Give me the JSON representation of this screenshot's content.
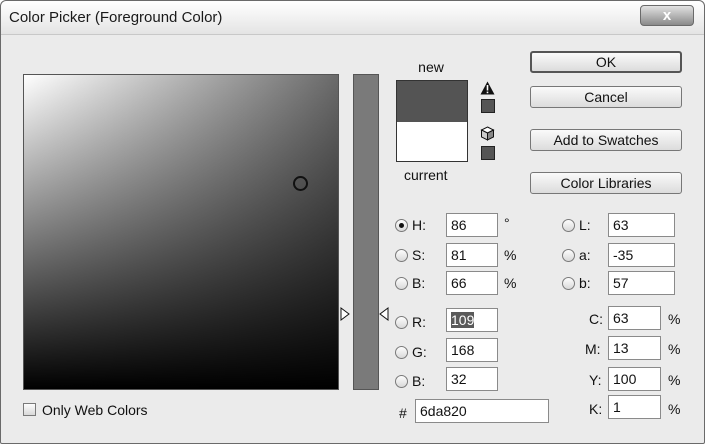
{
  "window": {
    "title": "Color Picker (Foreground Color)",
    "close_glyph": "x"
  },
  "swatches": {
    "new_label": "new",
    "current_label": "current"
  },
  "buttons": {
    "ok": "OK",
    "cancel": "Cancel",
    "add_to_swatches": "Add to Swatches",
    "color_libraries": "Color Libraries"
  },
  "hsb": {
    "h": {
      "label": "H:",
      "value": "86",
      "unit": "°",
      "selected": true
    },
    "s": {
      "label": "S:",
      "value": "81",
      "unit": "%"
    },
    "b": {
      "label": "B:",
      "value": "66",
      "unit": "%"
    }
  },
  "rgb": {
    "r": {
      "label": "R:",
      "value": "109"
    },
    "g": {
      "label": "G:",
      "value": "168"
    },
    "b": {
      "label": "B:",
      "value": "32"
    }
  },
  "lab": {
    "l": {
      "label": "L:",
      "value": "63"
    },
    "a": {
      "label": "a:",
      "value": "-35"
    },
    "b": {
      "label": "b:",
      "value": "57"
    }
  },
  "cmyk": {
    "c": {
      "label": "C:",
      "value": "63",
      "unit": "%"
    },
    "m": {
      "label": "M:",
      "value": "13",
      "unit": "%"
    },
    "y": {
      "label": "Y:",
      "value": "100",
      "unit": "%"
    },
    "k": {
      "label": "K:",
      "value": "1",
      "unit": "%"
    }
  },
  "hex": {
    "label": "#",
    "value": "6da820"
  },
  "only_web_colors": {
    "label": "Only Web Colors",
    "checked": false
  },
  "colors": {
    "new_swatch": "#545454",
    "current_swatch": "#ffffff"
  },
  "icons": {
    "gamut_warning": "warning-triangle-icon",
    "web_safe_warning": "cube-icon"
  }
}
